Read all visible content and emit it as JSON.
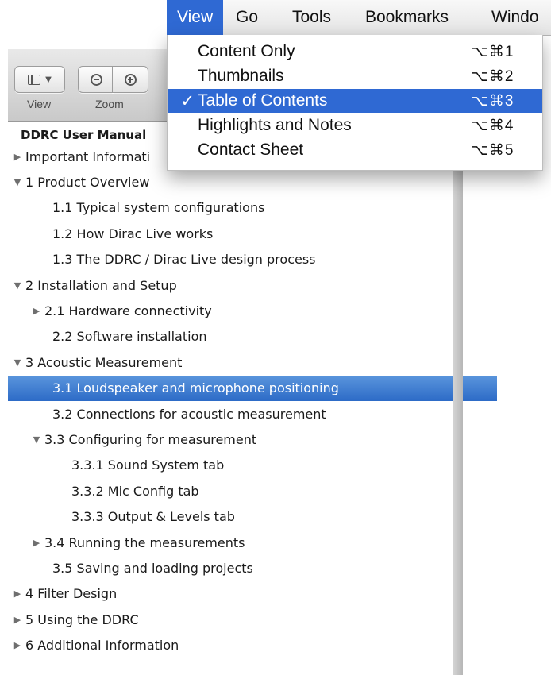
{
  "menubar": {
    "items": [
      {
        "label": "View"
      },
      {
        "label": "Go"
      },
      {
        "label": "Tools"
      },
      {
        "label": "Bookmarks"
      },
      {
        "label": "Windo"
      }
    ]
  },
  "view_menu": {
    "items": [
      {
        "label": "Content Only",
        "shortcut": "⌥⌘1",
        "checked": ""
      },
      {
        "label": "Thumbnails",
        "shortcut": "⌥⌘2",
        "checked": ""
      },
      {
        "label": "Table of Contents",
        "shortcut": "⌥⌘3",
        "checked": "✓"
      },
      {
        "label": "Highlights and Notes",
        "shortcut": "⌥⌘4",
        "checked": ""
      },
      {
        "label": "Contact Sheet",
        "shortcut": "⌥⌘5",
        "checked": ""
      }
    ]
  },
  "toolbar": {
    "view_caption": "View",
    "zoom_caption": "Zoom"
  },
  "toc": {
    "title": "DDRC User Manual",
    "rows": [
      {
        "label": "Important Informati",
        "triangle": "▶"
      },
      {
        "label": "1 Product Overview",
        "triangle": "▼"
      },
      {
        "label": "1.1 Typical system configurations",
        "triangle": ""
      },
      {
        "label": "1.2 How Dirac Live works",
        "triangle": ""
      },
      {
        "label": "1.3 The DDRC / Dirac Live design process",
        "triangle": ""
      },
      {
        "label": "2 Installation and Setup",
        "triangle": "▼"
      },
      {
        "label": "2.1 Hardware connectivity",
        "triangle": "▶"
      },
      {
        "label": "2.2 Software installation",
        "triangle": ""
      },
      {
        "label": "3 Acoustic Measurement",
        "triangle": "▼"
      },
      {
        "label": "3.1 Loudspeaker and microphone positioning",
        "triangle": ""
      },
      {
        "label": "3.2 Connections for acoustic measurement",
        "triangle": ""
      },
      {
        "label": "3.3 Configuring for measurement",
        "triangle": "▼"
      },
      {
        "label": "3.3.1 Sound System tab",
        "triangle": ""
      },
      {
        "label": "3.3.2 Mic Config tab",
        "triangle": ""
      },
      {
        "label": "3.3.3 Output & Levels tab",
        "triangle": ""
      },
      {
        "label": "3.4 Running the measurements",
        "triangle": "▶"
      },
      {
        "label": "3.5 Saving and loading projects",
        "triangle": ""
      },
      {
        "label": "4 Filter Design",
        "triangle": "▶"
      },
      {
        "label": "5 Using the DDRC",
        "triangle": "▶"
      },
      {
        "label": "6 Additional Information",
        "triangle": "▶"
      }
    ]
  },
  "colors": {
    "selection": "#2f69d3",
    "row_selection": "#3a78cf"
  }
}
